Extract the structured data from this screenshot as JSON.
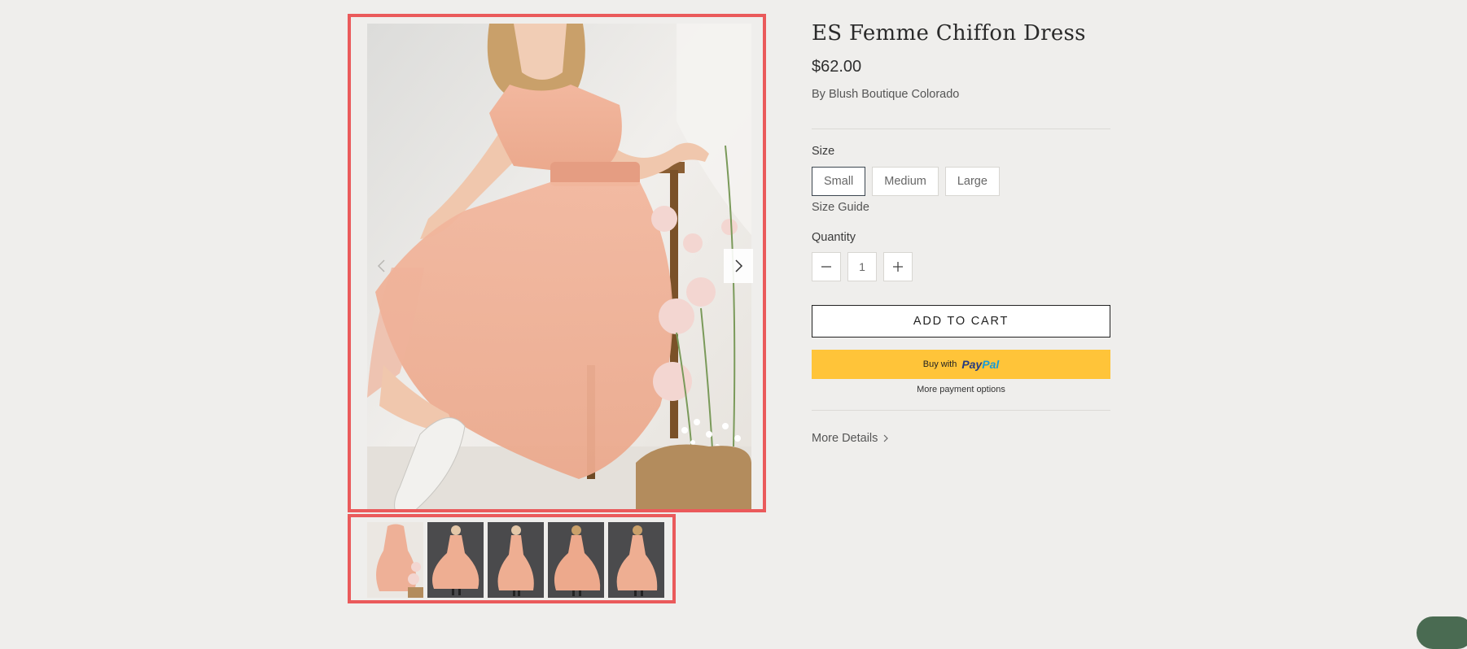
{
  "product": {
    "title": "ES Femme Chiffon Dress",
    "price": "$62.00",
    "vendor_prefix": "By ",
    "vendor": "Blush Boutique Colorado"
  },
  "size": {
    "label": "Size",
    "options": [
      "Small",
      "Medium",
      "Large"
    ],
    "selected": "Small",
    "guide_label": "Size Guide"
  },
  "quantity": {
    "label": "Quantity",
    "value": "1"
  },
  "buttons": {
    "add_to_cart": "ADD TO CART",
    "paypal_prefix": "Buy with",
    "paypal_brand_a": "Pay",
    "paypal_brand_b": "Pal",
    "more_payment": "More payment options",
    "more_details": "More Details"
  },
  "gallery": {
    "main_image": "dress-photo-peach-model-seated",
    "thumbnail_count": 5,
    "active_thumbnail": 1
  },
  "colors": {
    "highlight": "#ea5a5b",
    "paypal_yellow": "#ffc439",
    "dress": "#efb096",
    "background": "#efeeec"
  },
  "icons": {
    "prev": "chevron-left-icon",
    "next": "chevron-right-icon",
    "minus": "minus-icon",
    "plus": "plus-icon",
    "details": "chevron-right-small-icon"
  }
}
